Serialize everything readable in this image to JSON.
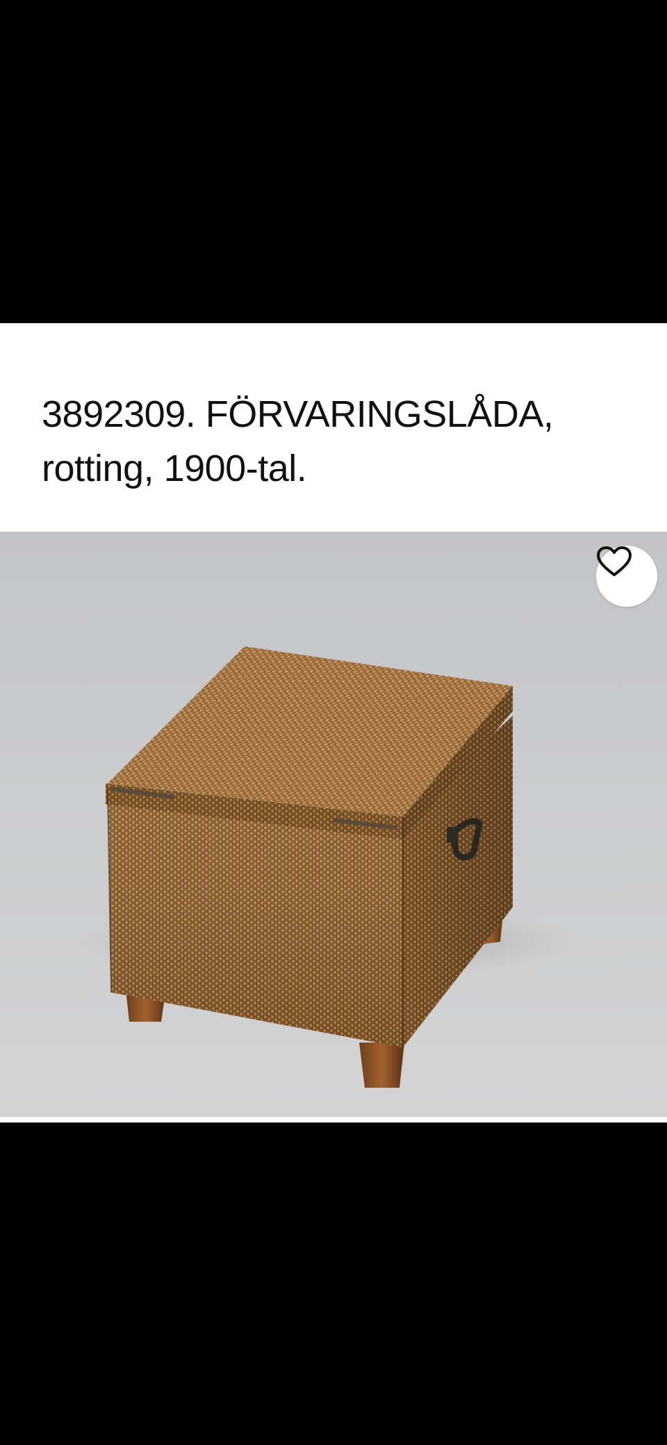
{
  "listing": {
    "title_line1": "3892309. FÖRVARINGSLÅDA,",
    "title_line2": "rotting, 1900-tal."
  },
  "favorite": {
    "icon": "heart-outline-icon"
  },
  "colors": {
    "background_top": "#000000",
    "title_bg": "#ffffff",
    "photo_bg": "#c8c9ca",
    "rattan": "#8a5a2e",
    "wood_leg": "#8c5327"
  }
}
